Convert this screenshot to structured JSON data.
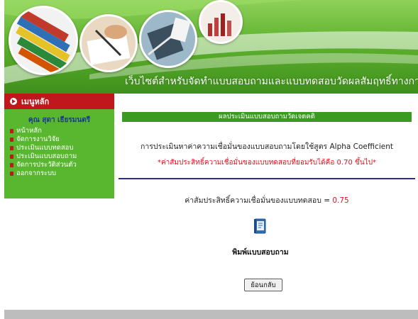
{
  "header": {
    "site_title": "เว็บไซต์สำหรับจัดทำแบบสอบถามและแบบทดสอบวัดผลสัมฤทธิ์ทางการเรียน"
  },
  "sidebar": {
    "menu_title": "เมนูหลัก",
    "user_name": "คุณ สุดา เธียรมนตรี",
    "items": [
      {
        "label": "หน้าหลัก"
      },
      {
        "label": "จัดการงานวิจัย"
      },
      {
        "label": "ประเมินแบบทดสอบ"
      },
      {
        "label": "ประเมินแบบสอบถาม"
      },
      {
        "label": "จัดการประวัติส่วนตัว"
      },
      {
        "label": "ออกจากระบบ"
      }
    ]
  },
  "main": {
    "section_title": "ผลประเมินแบบสอบถามวัดเจตคติ",
    "method_text": "การประเมินหาค่าความเชื่อมั่นของแบบสอบถามโดยใช้สูตร Alpha Coefficient",
    "note_text": "*ค่าสัมประสิทธิ์ความเชื่อมั่นของแบบทดสอบที่ยอมรับได้คือ 0.70 ขึ้นไป*",
    "coef_label": "ค่าสัมประสิทธิ์ความเชื่อมั่นของแบบทดสอบ =",
    "coef_value": "0.75",
    "print_label": "พิมพ์แบบสอบถาม",
    "back_label": "ย้อนกลับ"
  },
  "colors": {
    "banner_green": "#5fb22e",
    "sidebar_green": "#58b62f",
    "menu_header_red": "#c0171c",
    "section_bar_green": "#3b9b21",
    "accent_red": "#e0101a",
    "divider_navy": "#2b2f8a"
  },
  "icons": {
    "print": "printer-document-icon",
    "menu_bullet": "arrow-bullet-icon"
  }
}
